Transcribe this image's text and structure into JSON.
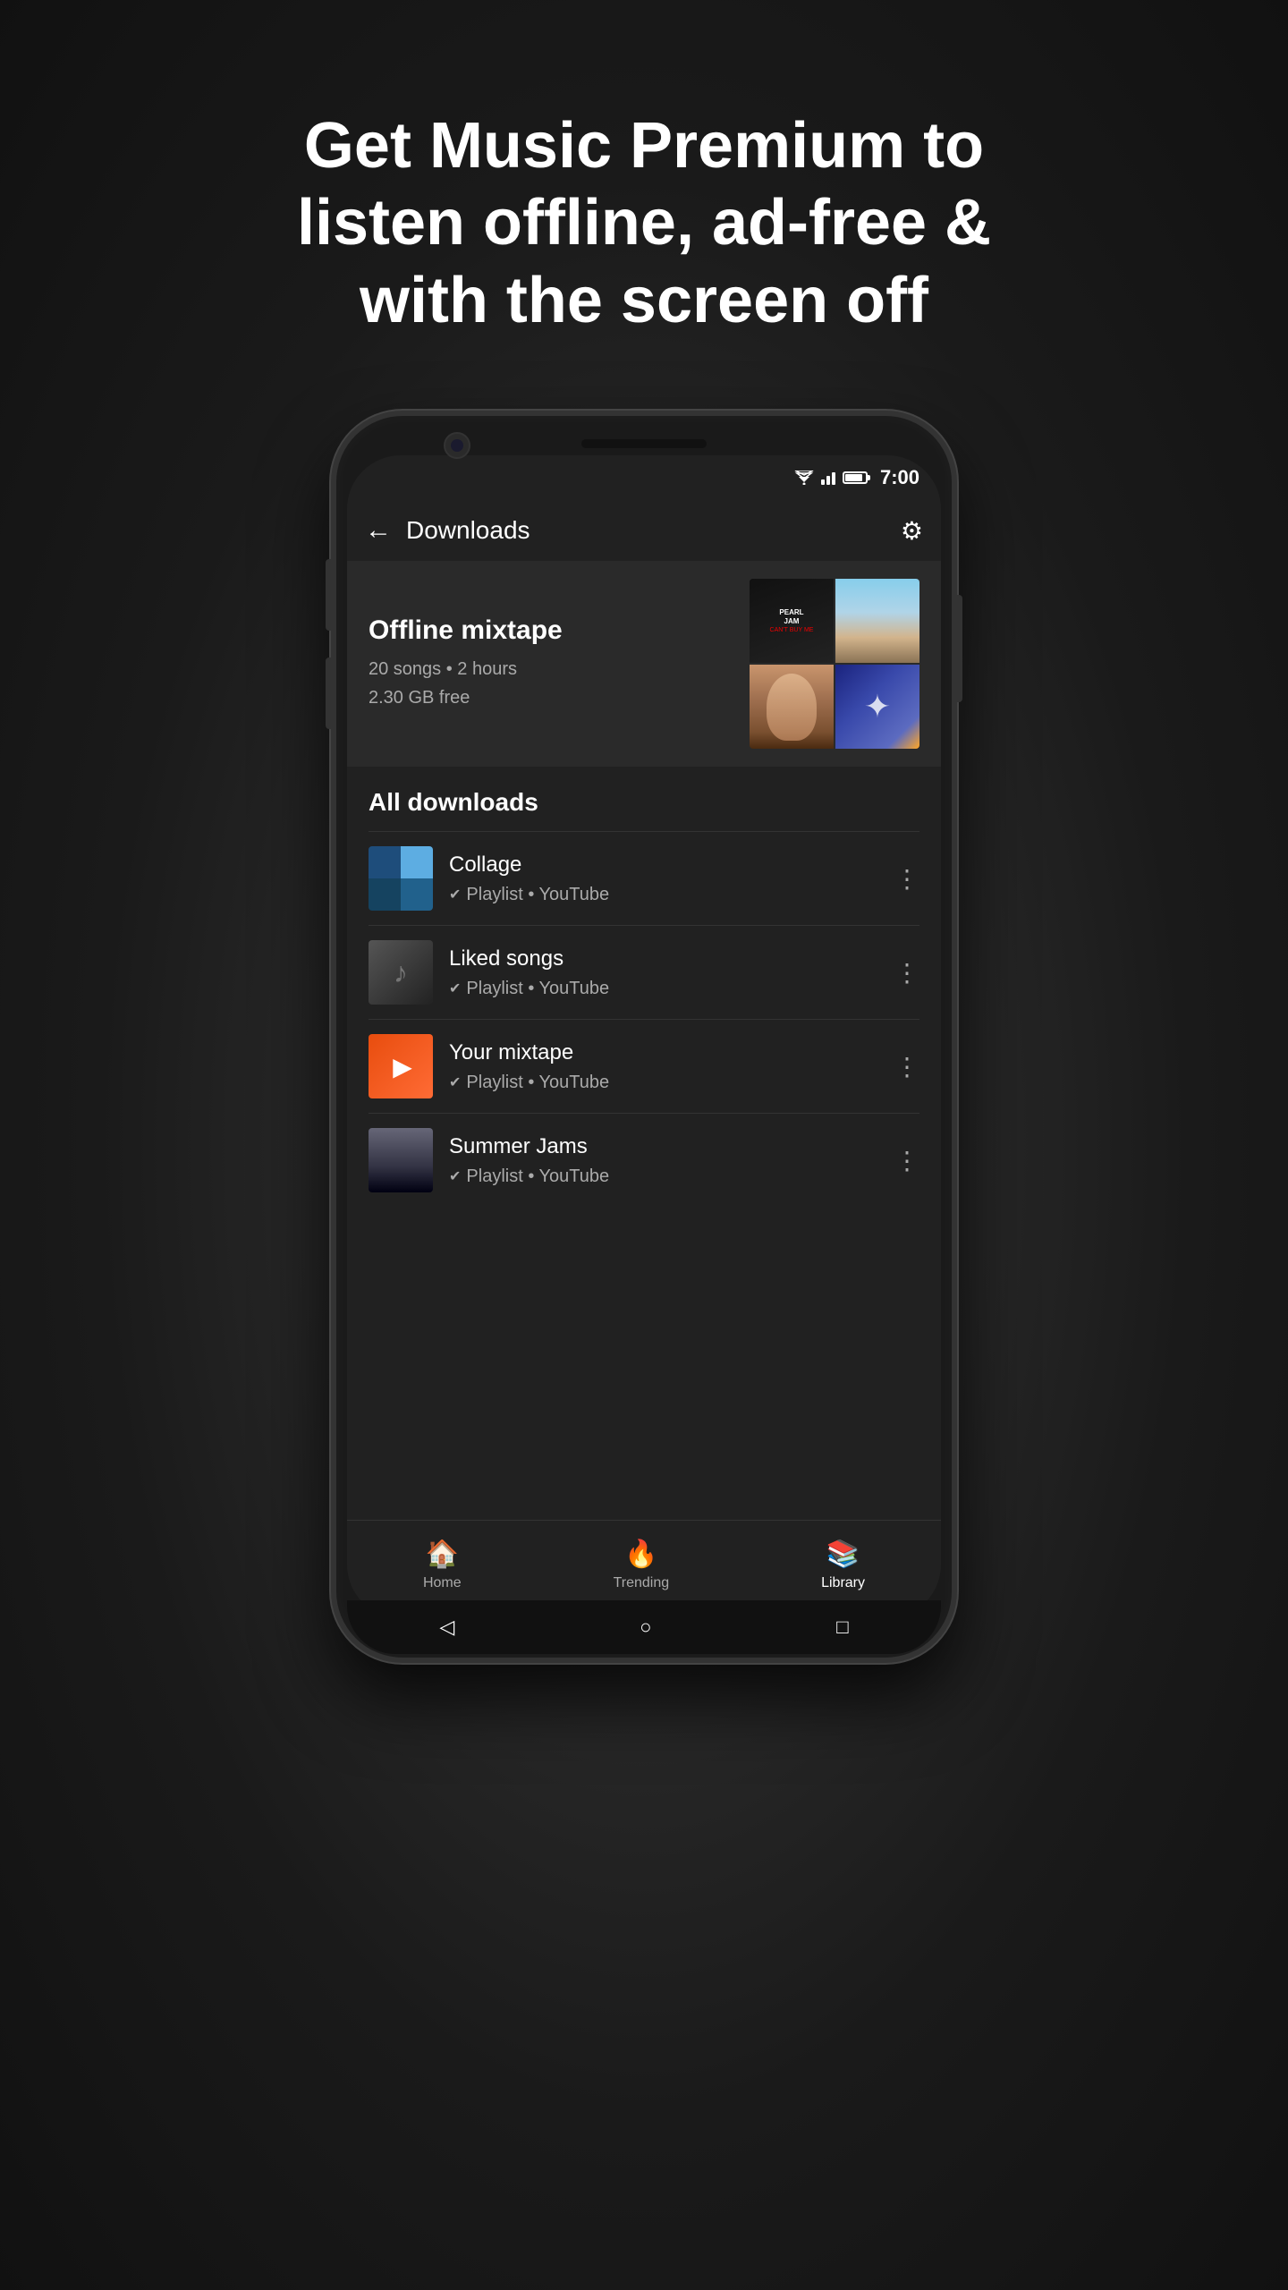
{
  "page": {
    "headline": "Get Music Premium to listen offline, ad-free & with the screen off"
  },
  "statusBar": {
    "time": "7:00"
  },
  "header": {
    "title": "Downloads",
    "backLabel": "←",
    "settingsLabel": "⚙"
  },
  "offlineMixtape": {
    "title": "Offline mixtape",
    "songCount": "20 songs • 2 hours",
    "storageInfo": "2.30 GB free"
  },
  "allDownloads": {
    "sectionTitle": "All downloads",
    "items": [
      {
        "name": "Collage",
        "meta": "Playlist • YouTube",
        "thumbType": "collage"
      },
      {
        "name": "Liked songs",
        "meta": "Playlist • YouTube",
        "thumbType": "liked"
      },
      {
        "name": "Your mixtape",
        "meta": "Playlist • YouTube",
        "thumbType": "mixtape"
      },
      {
        "name": "Summer Jams",
        "meta": "Playlist • YouTube",
        "thumbType": "summer"
      }
    ]
  },
  "bottomNav": {
    "items": [
      {
        "label": "Home",
        "icon": "🏠",
        "active": false
      },
      {
        "label": "Trending",
        "icon": "🔥",
        "active": false
      },
      {
        "label": "Library",
        "icon": "📚",
        "active": true
      }
    ]
  },
  "systemNav": {
    "back": "◁",
    "home": "○",
    "recents": "□"
  }
}
